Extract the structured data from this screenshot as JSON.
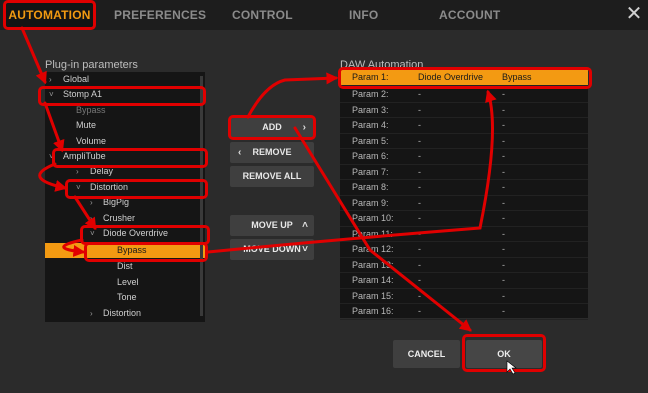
{
  "tabs": [
    {
      "label": "AUTOMATION"
    },
    {
      "label": "PREFERENCES"
    },
    {
      "label": "CONTROL"
    },
    {
      "label": "INFO"
    },
    {
      "label": "ACCOUNT"
    }
  ],
  "close_label": "✕",
  "left_title": "Plug-in parameters",
  "right_title": "DAW Automation",
  "tree": [
    {
      "label": "Global"
    },
    {
      "label": "Stomp A1"
    },
    {
      "label": "Bypass"
    },
    {
      "label": "Mute"
    },
    {
      "label": "Volume"
    },
    {
      "label": "AmpliTube"
    },
    {
      "label": "Delay"
    },
    {
      "label": "Distortion"
    },
    {
      "label": "BigPig"
    },
    {
      "label": "Crusher"
    },
    {
      "label": "Diode Overdrive"
    },
    {
      "label": "Bypass"
    },
    {
      "label": "Dist"
    },
    {
      "label": "Level"
    },
    {
      "label": "Tone"
    },
    {
      "label": "Distortion"
    }
  ],
  "buttons": {
    "add": "ADD",
    "remove": "REMOVE",
    "remove_all": "REMOVE ALL",
    "move_up": "MOVE UP",
    "move_down": "MOVE DOWN"
  },
  "daw": [
    {
      "param": "Param 1:",
      "name": "Diode Overdrive",
      "value": "Bypass"
    },
    {
      "param": "Param 2:",
      "name": "-",
      "value": "-"
    },
    {
      "param": "Param 3:",
      "name": "-",
      "value": "-"
    },
    {
      "param": "Param 4:",
      "name": "-",
      "value": "-"
    },
    {
      "param": "Param 5:",
      "name": "-",
      "value": "-"
    },
    {
      "param": "Param 6:",
      "name": "-",
      "value": "-"
    },
    {
      "param": "Param 7:",
      "name": "-",
      "value": "-"
    },
    {
      "param": "Param 8:",
      "name": "-",
      "value": "-"
    },
    {
      "param": "Param 9:",
      "name": "-",
      "value": "-"
    },
    {
      "param": "Param 10:",
      "name": "-",
      "value": "-"
    },
    {
      "param": "Param 11:",
      "name": "-",
      "value": "-"
    },
    {
      "param": "Param 12:",
      "name": "-",
      "value": "-"
    },
    {
      "param": "Param 13:",
      "name": "-",
      "value": "-"
    },
    {
      "param": "Param 14:",
      "name": "-",
      "value": "-"
    },
    {
      "param": "Param 15:",
      "name": "-",
      "value": "-"
    },
    {
      "param": "Param 16:",
      "name": "-",
      "value": "-"
    }
  ],
  "footer": {
    "cancel": "CANCEL",
    "ok": "OK"
  }
}
